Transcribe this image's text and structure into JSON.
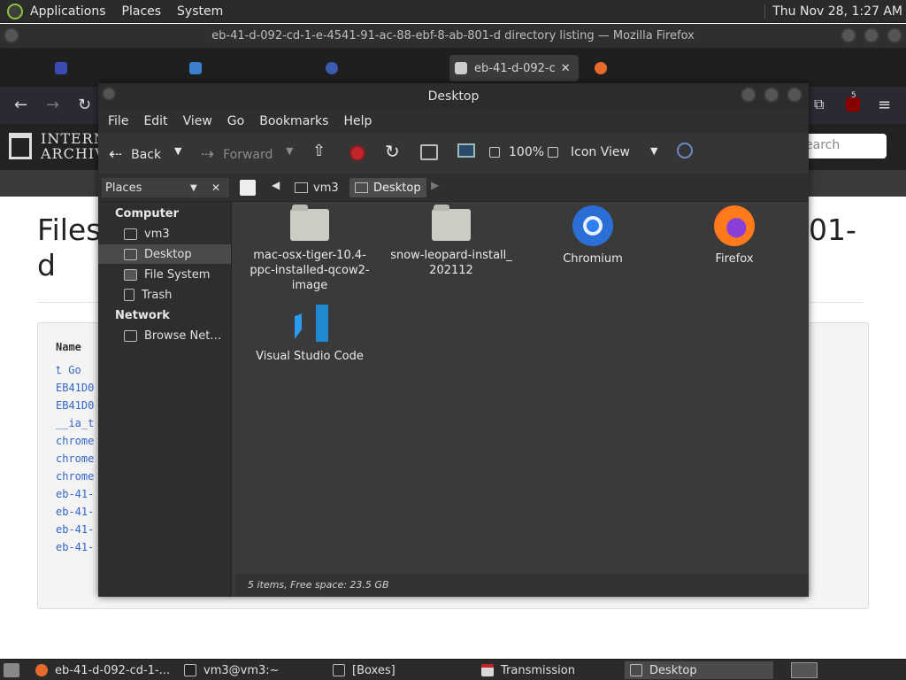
{
  "top_panel": {
    "menus": [
      "Applications",
      "Places",
      "System"
    ],
    "clock": "Thu Nov 28,  1:27 AM"
  },
  "firefox": {
    "window_title": "eb-41-d-092-cd-1-e-4541-91-ac-88-ebf-8-ab-801-d directory listing — Mozilla Firefox",
    "active_tab_label": "eb-41-d-092-c",
    "search_placeholder": "earch",
    "ia_logo_text_line1": "INTERN",
    "ia_logo_text_line2": "ARCHIV",
    "page_title_left": "Files",
    "page_title_right": "01-",
    "page_title_d": "d",
    "listing_header": "Name",
    "listing_rows": [
      "⮤ Go",
      "EB41D0",
      "EB41D0",
      "__ia_t",
      "chrome",
      "chrome",
      "chrome",
      "eb-41-",
      "eb-41-",
      "eb-41-",
      "eb-41-"
    ],
    "extension_badge": "5"
  },
  "file_manager": {
    "title": "Desktop",
    "menus": [
      "File",
      "Edit",
      "View",
      "Go",
      "Bookmarks",
      "Help"
    ],
    "toolbar": {
      "back": "Back",
      "forward": "Forward",
      "zoom": "100%",
      "view_mode": "Icon View"
    },
    "sidebar_selector": "Places",
    "breadcrumb": [
      "vm3",
      "Desktop"
    ],
    "sidebar": {
      "computer_heading": "Computer",
      "computer_items": [
        "vm3",
        "Desktop",
        "File System",
        "Trash"
      ],
      "network_heading": "Network",
      "network_items": [
        "Browse Net…"
      ]
    },
    "files": [
      {
        "name": "mac-osx-tiger-10.4-ppc-installed-qcow2-image",
        "line1": "mac-osx-tiger-10.4-",
        "line2": "ppc-installed-qcow2-",
        "line3": "image",
        "icon": "folder-icon"
      },
      {
        "name": "snow-leopard-install_202112",
        "line1": "snow-leopard-install_",
        "line2": "202112",
        "icon": "folder-icon"
      },
      {
        "name": "Chromium",
        "icon": "chromium-icon"
      },
      {
        "name": "Firefox",
        "icon": "firefox-icon"
      },
      {
        "name": "Visual Studio Code",
        "icon": "vscode-icon"
      }
    ],
    "status": "5 items, Free space: 23.5 GB"
  },
  "taskbar": {
    "tasks": [
      "eb-41-d-092-cd-1-...",
      "vm3@vm3:~",
      "[Boxes]",
      "Transmission",
      "Desktop"
    ]
  }
}
